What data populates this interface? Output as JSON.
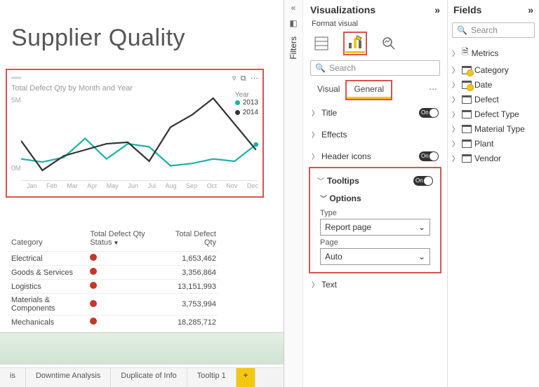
{
  "report": {
    "title": "Supplier Quality"
  },
  "chart": {
    "title": "Total Defect Qty by Month and Year",
    "legend_title": "Year",
    "series_a": "2013",
    "series_b": "2014",
    "y_top": "5M",
    "y_bot": "0M",
    "months": {
      "m0": "Jan",
      "m1": "Feb",
      "m2": "Mar",
      "m3": "Apr",
      "m4": "May",
      "m5": "Jun",
      "m6": "Jul",
      "m7": "Aug",
      "m8": "Sep",
      "m9": "Oct",
      "m10": "Nov",
      "m11": "Dec"
    }
  },
  "chart_data": {
    "type": "line",
    "title": "Total Defect Qty by Month and Year",
    "xlabel": "",
    "ylabel": "Total Defect Qty",
    "ylim": [
      0,
      6000000
    ],
    "categories": [
      "Jan",
      "Feb",
      "Mar",
      "Apr",
      "May",
      "Jun",
      "Jul",
      "Aug",
      "Sep",
      "Oct",
      "Nov",
      "Dec"
    ],
    "series": [
      {
        "name": "2013",
        "color": "#17b2a6",
        "values": [
          1400000,
          1200000,
          1500000,
          2800000,
          1400000,
          2400000,
          2200000,
          900000,
          1100000,
          1400000,
          1200000,
          2300000
        ]
      },
      {
        "name": "2014",
        "color": "#333333",
        "values": [
          2600000,
          600000,
          1600000,
          2000000,
          2400000,
          2500000,
          1200000,
          3500000,
          4300000,
          5500000,
          3700000,
          2000000
        ]
      }
    ],
    "y_ticks": [
      0,
      5000000
    ],
    "y_tick_labels": [
      "0M",
      "5M"
    ],
    "legend_title": "Year",
    "legend_position": "right"
  },
  "table": {
    "col0": "Category",
    "col1": "Total Defect Qty Status",
    "col2": "Total Defect Qty",
    "r0c0": "Electrical",
    "r0c2": "1,653,462",
    "r1c0": "Goods & Services",
    "r1c2": "3,356,864",
    "r2c0": "Logistics",
    "r2c2": "13,151,993",
    "r3c0": "Materials & Components",
    "r3c2": "3,753,994",
    "r4c0": "Mechanicals",
    "r4c2": "18,285,712"
  },
  "tabs": {
    "t0": "is",
    "t1": "Downtime Analysis",
    "t2": "Duplicate of Info",
    "t3": "Tooltip 1",
    "add": "+"
  },
  "filters": {
    "label": "Filters"
  },
  "viz": {
    "title": "Visualizations",
    "format_label": "Format visual",
    "search": "Search",
    "tab_visual": "Visual",
    "tab_general": "General",
    "sect_title": "Title",
    "sect_effects": "Effects",
    "sect_header": "Header icons",
    "sect_tooltips": "Tooltips",
    "sect_options": "Options",
    "type_label": "Type",
    "type_value": "Report page",
    "page_label": "Page",
    "page_value": "Auto",
    "sect_text": "Text",
    "on": "On"
  },
  "fields": {
    "title": "Fields",
    "search": "Search",
    "f0": "Metrics",
    "f1": "Category",
    "f2": "Date",
    "f3": "Defect",
    "f4": "Defect Type",
    "f5": "Material Type",
    "f6": "Plant",
    "f7": "Vendor"
  }
}
